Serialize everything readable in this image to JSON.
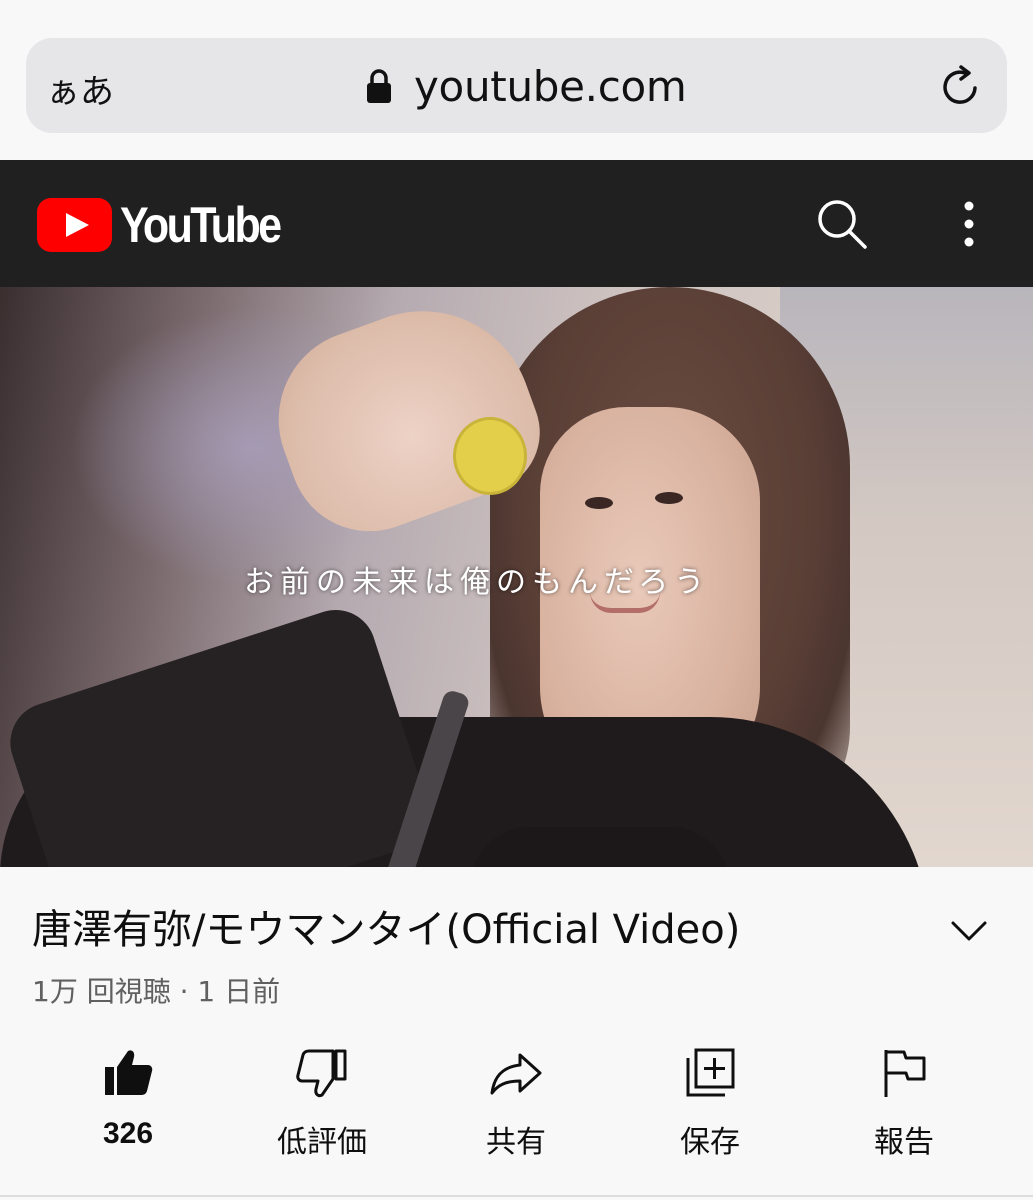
{
  "browser": {
    "text_size_label": "ぁあ",
    "url": "youtube.com",
    "lock_icon": "lock-icon",
    "reload_icon": "reload-icon"
  },
  "header": {
    "logo_text": "YouTube",
    "brand_color": "#FF0000",
    "background": "#202020",
    "search_icon": "search-icon",
    "more_icon": "more-vertical-icon"
  },
  "video": {
    "subtitle": "お前の未来は俺のもんだろう"
  },
  "info": {
    "title": "唐澤有弥/モウマンタイ(Official Video)",
    "meta": "1万 回視聴 · 1 日前",
    "expand_icon": "chevron-down-icon"
  },
  "actions": [
    {
      "icon": "thumbs-up-filled-icon",
      "label": "326"
    },
    {
      "icon": "thumbs-down-icon",
      "label": "低評価"
    },
    {
      "icon": "share-icon",
      "label": "共有"
    },
    {
      "icon": "save-playlist-icon",
      "label": "保存"
    },
    {
      "icon": "flag-icon",
      "label": "報告"
    }
  ]
}
